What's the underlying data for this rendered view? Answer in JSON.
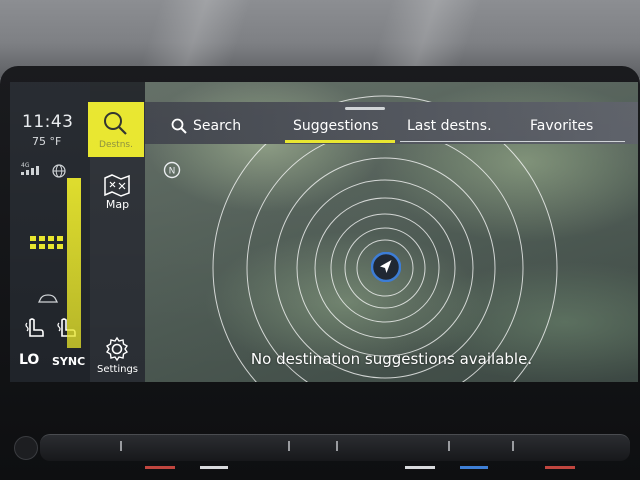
{
  "status": {
    "time": "11:43",
    "temperature": "75 °F",
    "network": "4G",
    "climate_left": "LO",
    "climate_sync": "SYNC"
  },
  "nav": {
    "destinations_label": "Destns.",
    "map_label": "Map",
    "settings_label": "Settings"
  },
  "tabs": {
    "search": "Search",
    "suggestions": "Suggestions",
    "last_destinations": "Last destns.",
    "favorites": "Favorites",
    "active": "Suggestions"
  },
  "map": {
    "compass": "N",
    "message": "No destination suggestions available."
  },
  "colors": {
    "accent": "#e8e62a",
    "vehicle": "#3a7bd5"
  },
  "icons": {
    "search": "search-icon",
    "map": "map-icon",
    "settings": "gear-icon",
    "globe": "globe-icon",
    "signal": "signal-icon",
    "compass": "compass-icon",
    "vehicle": "vehicle-position-icon"
  }
}
